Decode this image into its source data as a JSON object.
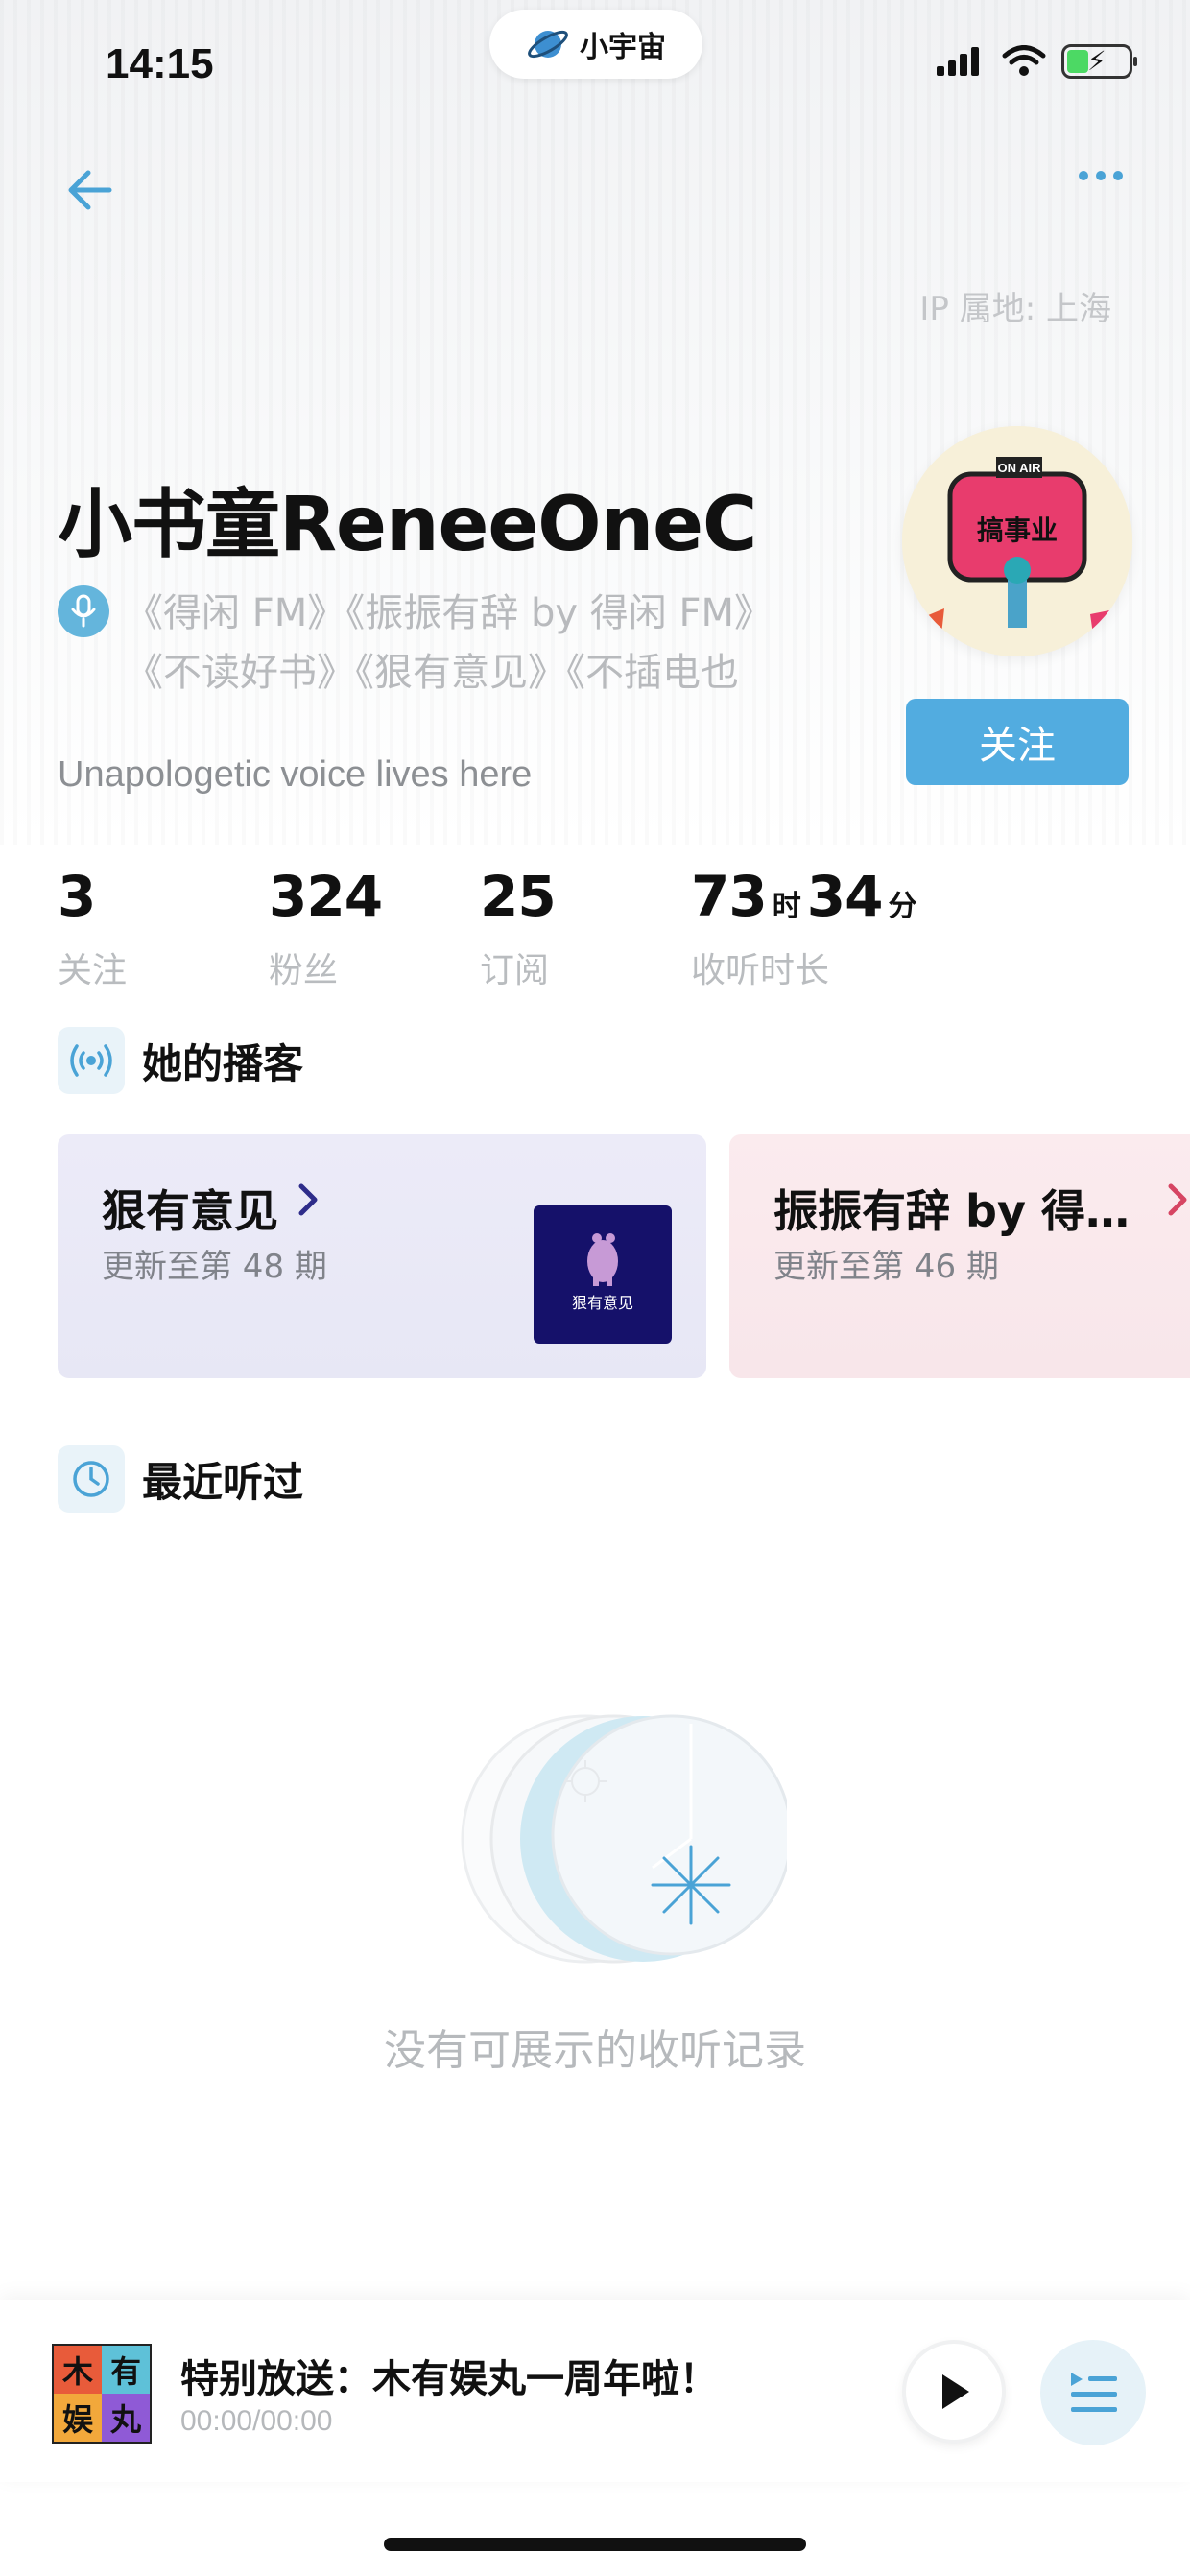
{
  "status_bar": {
    "time": "14:15",
    "app_name": "小宇宙"
  },
  "profile": {
    "ip_location": "IP 属地: 上海",
    "username": "小书童ReneeOneC",
    "podcasts_line1": "《得闲 FM》《振振有辞 by 得闲 FM》",
    "podcasts_line2": "《不读好书》《狠有意见》《不插电也",
    "bio": "Unapologetic voice lives here",
    "follow_label": "关注",
    "avatar_text_top": "ON AIR",
    "avatar_text_main": "搞事业"
  },
  "stats": {
    "following": {
      "value": "3",
      "label": "关注"
    },
    "followers": {
      "value": "324",
      "label": "粉丝"
    },
    "subscriptions": {
      "value": "25",
      "label": "订阅"
    },
    "listen_time": {
      "hours": "73",
      "hour_unit": "时",
      "minutes": "34",
      "minute_unit": "分",
      "label": "收听时长"
    }
  },
  "sections": {
    "podcasts_title": "她的播客",
    "recent_title": "最近听过"
  },
  "podcast_cards": [
    {
      "title": "狠有意见",
      "subtitle": "更新至第 48 期",
      "cover_text": "狠有意见"
    },
    {
      "title": "振振有辞 by 得…",
      "subtitle": "更新至第 46 期"
    }
  ],
  "empty_state": {
    "message": "没有可展示的收听记录"
  },
  "player": {
    "title": "特别放送：木有娱丸一周年啦！",
    "time": "00:00/00:00",
    "cover_chars": [
      "木",
      "有",
      "娱",
      "丸"
    ]
  },
  "colors": {
    "accent": "#52ace0",
    "card_1_bg": "#ecebf8",
    "card_2_bg": "#fbebee",
    "card_1_chevron": "#2e2c8a",
    "card_2_chevron": "#d64563"
  }
}
